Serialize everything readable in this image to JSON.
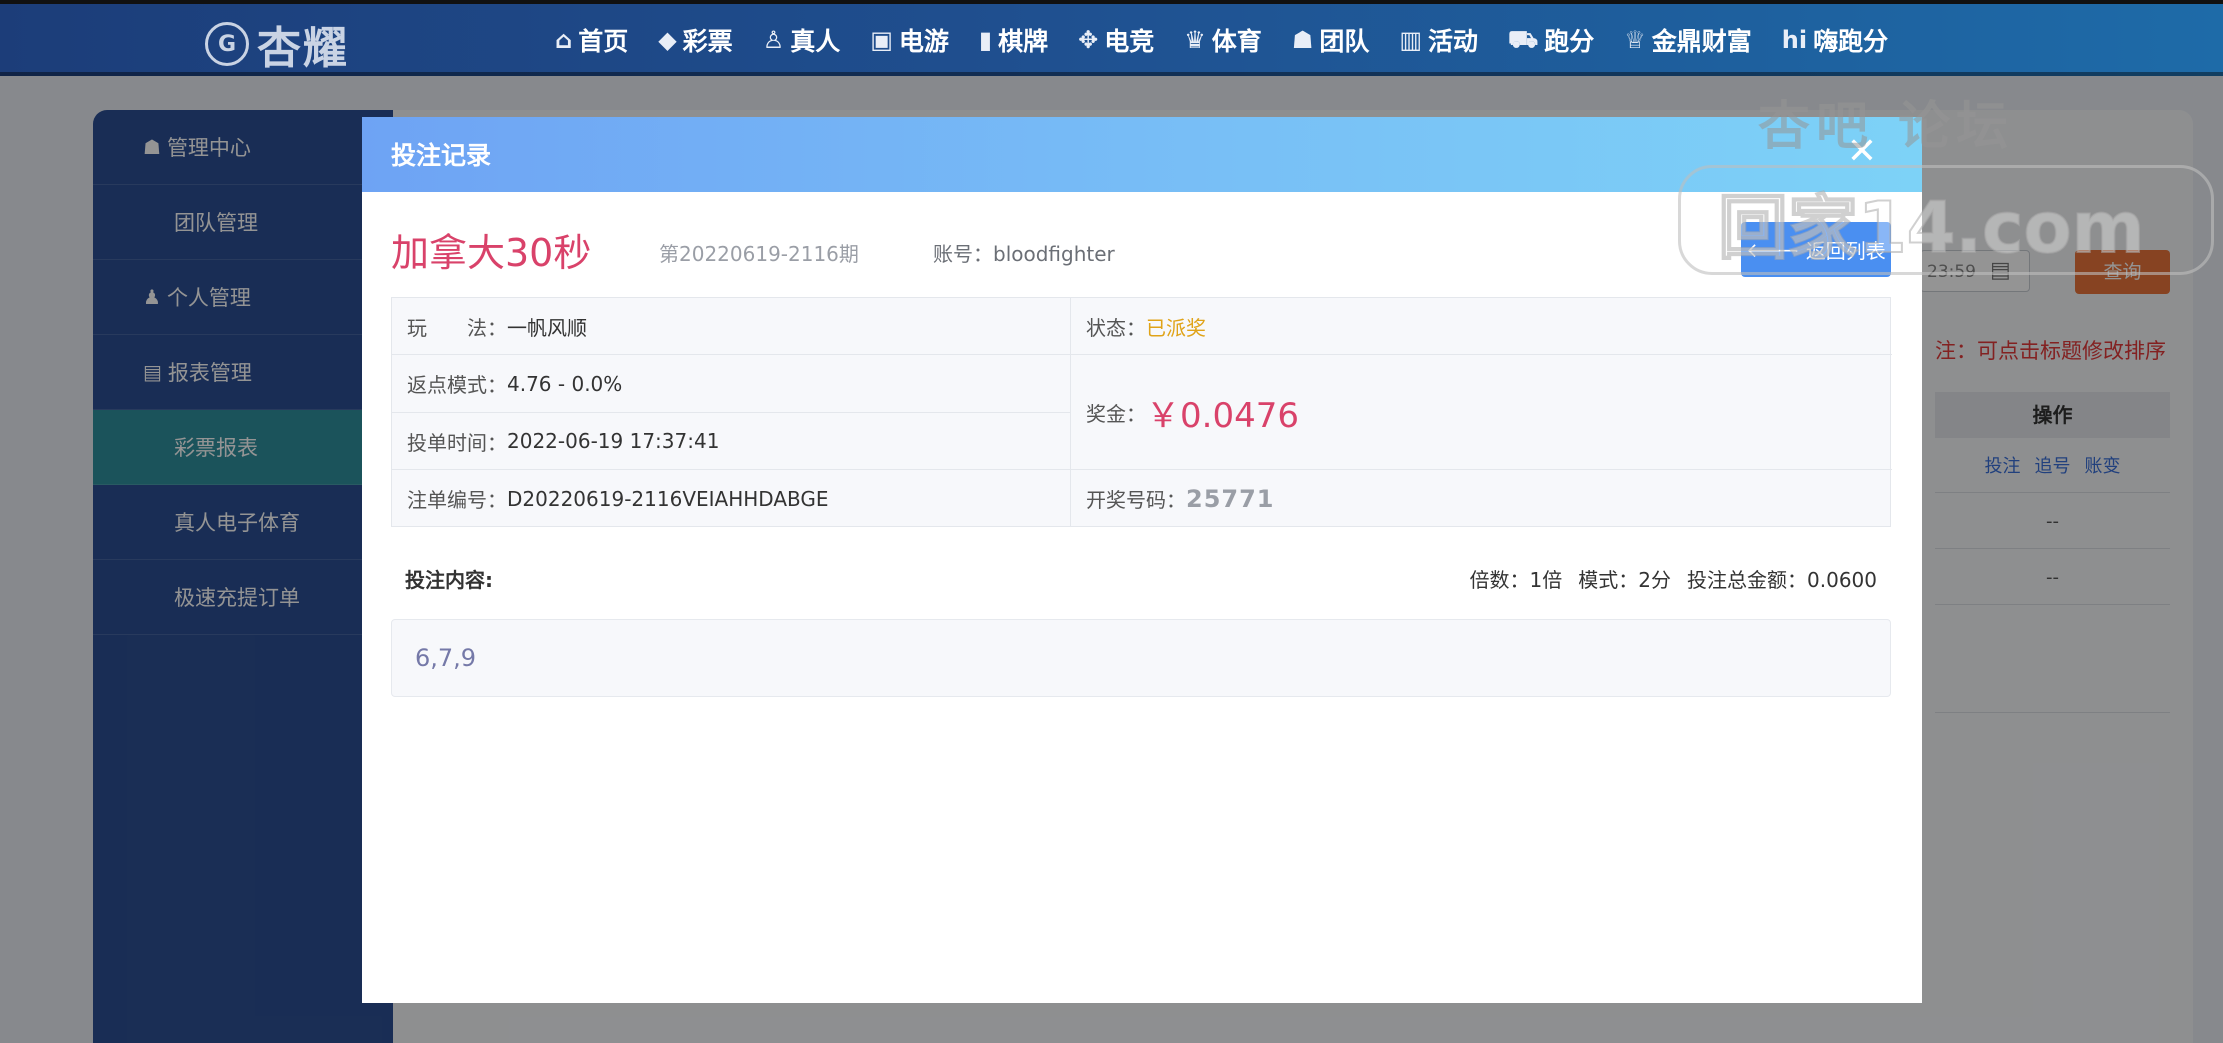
{
  "brand": {
    "seal": "G",
    "name": "杏耀"
  },
  "nav": [
    {
      "label": "首页",
      "icon": "home-icon",
      "glyph": "⌂"
    },
    {
      "label": "彩票",
      "icon": "lottery-icon",
      "glyph": "◆"
    },
    {
      "label": "真人",
      "icon": "live-dealer-icon",
      "glyph": "♙"
    },
    {
      "label": "电游",
      "icon": "slot-machine-icon",
      "glyph": "▣"
    },
    {
      "label": "棋牌",
      "icon": "cards-icon",
      "glyph": "▮"
    },
    {
      "label": "电竞",
      "icon": "gamepad-icon",
      "glyph": "✥"
    },
    {
      "label": "体育",
      "icon": "trophy-icon",
      "glyph": "♛"
    },
    {
      "label": "团队",
      "icon": "team-icon",
      "glyph": "☗"
    },
    {
      "label": "活动",
      "icon": "gift-icon",
      "glyph": "▥"
    },
    {
      "label": "跑分",
      "icon": "car-icon",
      "glyph": "⛟"
    },
    {
      "label": "金鼎财富",
      "icon": "wealth-icon",
      "glyph": "♕"
    },
    {
      "label": "嗨跑分",
      "icon": "hi-icon",
      "glyph": "hi"
    }
  ],
  "sidebar": {
    "items": [
      {
        "label": "管理中心",
        "type": "group",
        "icon": "team-icon",
        "glyph": "☗"
      },
      {
        "label": "团队管理",
        "type": "sub"
      },
      {
        "label": "个人管理",
        "type": "group",
        "icon": "user-icon",
        "glyph": "♟"
      },
      {
        "label": "报表管理",
        "type": "group",
        "icon": "report-icon",
        "glyph": "▤"
      },
      {
        "label": "彩票报表",
        "type": "sub",
        "active": true
      },
      {
        "label": "真人电子体育",
        "type": "sub"
      },
      {
        "label": "极速充提订单",
        "type": "sub"
      }
    ]
  },
  "background": {
    "date_value": "23:59",
    "query_label": "查询",
    "note": "注：可点击标题修改排序",
    "table_header": "操作",
    "row_links": [
      "投注",
      "追号",
      "账变"
    ],
    "row_empty": "--"
  },
  "modal": {
    "title": "投注记录",
    "close_glyph": "✕",
    "lottery_name": "加拿大30秒",
    "period": "第20220619-2116期",
    "account_label": "账号：",
    "account_value": "bloodfighter",
    "back_label": "返回列表",
    "info": {
      "play_label": "玩　　法：",
      "play_value": "一帆风顺",
      "status_label": "状态：",
      "status_value": "已派奖",
      "rebate_label": "返点模式：",
      "rebate_value": "4.76 - 0.0%",
      "prize_label": "奖金：",
      "prize_value": "￥0.0476",
      "time_label": "投单时间：",
      "time_value": "2022-06-19 17:37:41",
      "order_label": "注单编号：",
      "order_value": "D20220619-2116VEIAHHDABGE",
      "draw_label": "开奖号码：",
      "draw_value": "25771"
    },
    "bet": {
      "label": "投注内容:",
      "multiple_label": "倍数：",
      "multiple_value": "1倍",
      "mode_label": "模式：",
      "mode_value": "2分",
      "total_label": "投注总金额：",
      "total_value": "0.0600",
      "numbers": "6,7,9"
    }
  },
  "watermark": {
    "top": "杏吧 论坛",
    "big": "回家14.com"
  }
}
